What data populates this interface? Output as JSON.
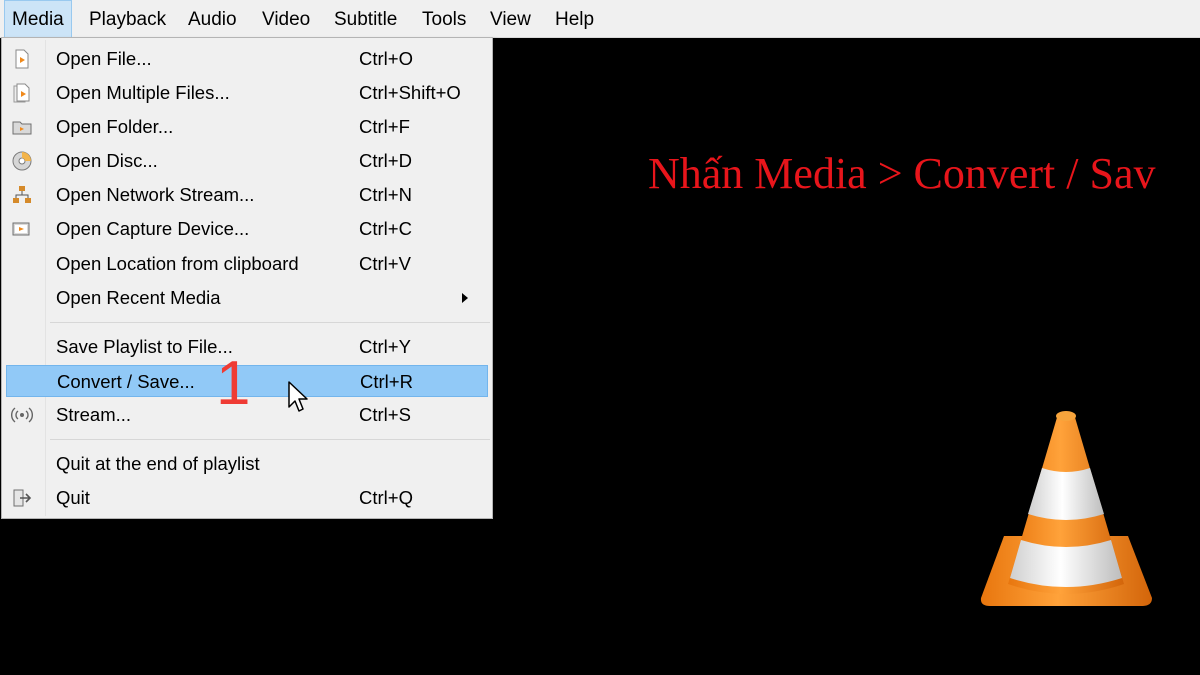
{
  "menubar": {
    "items": [
      "Media",
      "Playback",
      "Audio",
      "Video",
      "Subtitle",
      "Tools",
      "View",
      "Help"
    ]
  },
  "media_menu": {
    "items": [
      {
        "label": "Open File...",
        "shortcut": "Ctrl+O",
        "icon": "file-play-icon"
      },
      {
        "label": "Open Multiple Files...",
        "shortcut": "Ctrl+Shift+O",
        "icon": "files-play-icon"
      },
      {
        "label": "Open Folder...",
        "shortcut": "Ctrl+F",
        "icon": "folder-icon"
      },
      {
        "label": "Open Disc...",
        "shortcut": "Ctrl+D",
        "icon": "disc-icon"
      },
      {
        "label": "Open Network Stream...",
        "shortcut": "Ctrl+N",
        "icon": "network-icon"
      },
      {
        "label": "Open Capture Device...",
        "shortcut": "Ctrl+C",
        "icon": "capture-device-icon"
      },
      {
        "label": "Open Location from clipboard",
        "shortcut": "Ctrl+V",
        "icon": ""
      },
      {
        "label": "Open Recent Media",
        "shortcut": "",
        "icon": "",
        "submenu": true
      },
      {
        "label": "Save Playlist to File...",
        "shortcut": "Ctrl+Y",
        "icon": ""
      },
      {
        "label": "Convert / Save...",
        "shortcut": "Ctrl+R",
        "icon": "",
        "highlighted": true
      },
      {
        "label": "Stream...",
        "shortcut": "Ctrl+S",
        "icon": "stream-icon"
      },
      {
        "label": "Quit at the end of playlist",
        "shortcut": "",
        "icon": ""
      },
      {
        "label": "Quit",
        "shortcut": "Ctrl+Q",
        "icon": "quit-icon"
      }
    ]
  },
  "overlay": {
    "instruction": "Nhấn Media > Convert / Sav",
    "step_number": "1"
  },
  "colors": {
    "menubar_bg": "#f0f0f0",
    "highlight": "#91c9f7",
    "instruction_text": "#e8151b",
    "cone_orange": "#f7941d"
  }
}
